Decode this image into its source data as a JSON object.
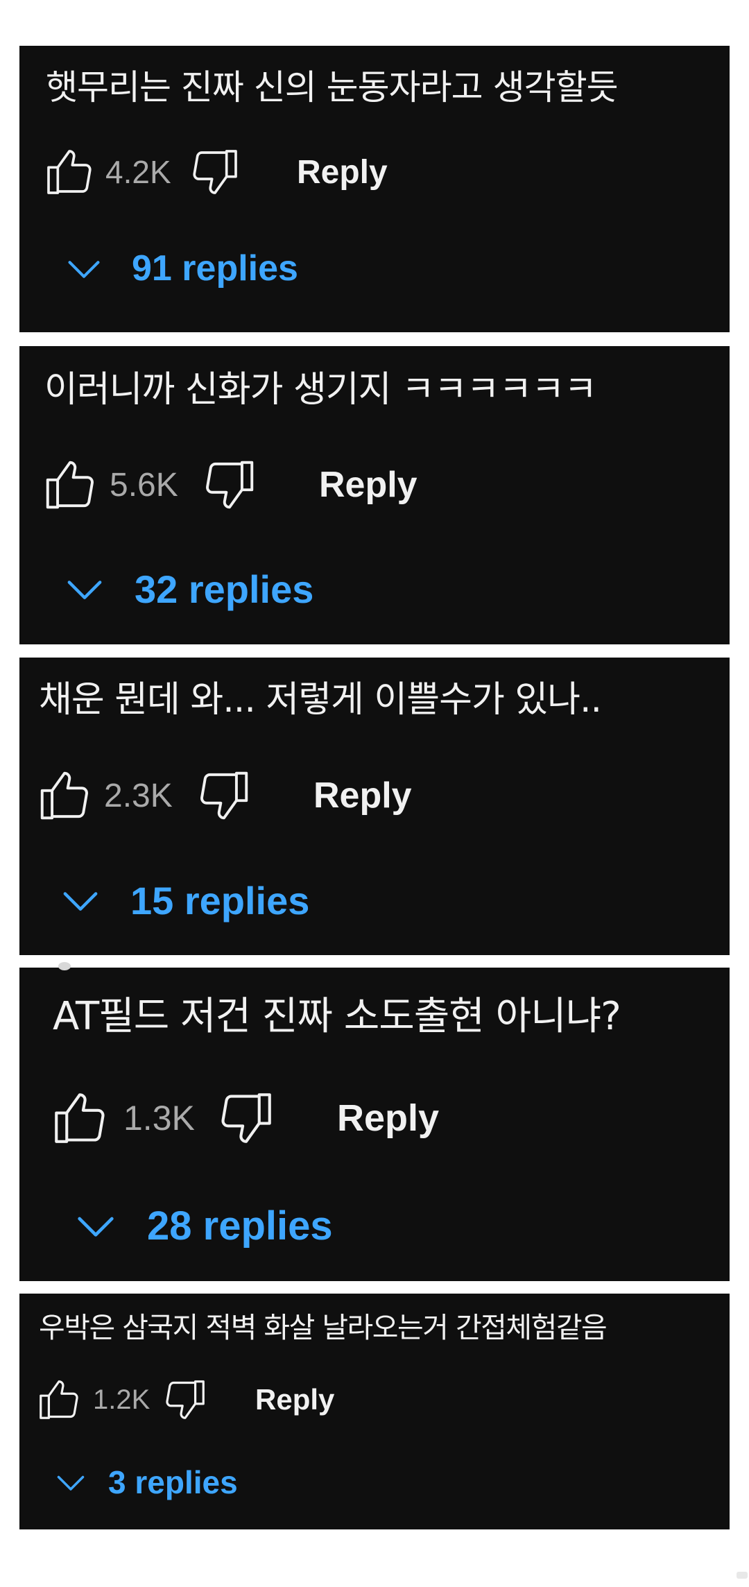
{
  "comments": [
    {
      "text": "햇무리는 진짜 신의 눈동자라고 생각할듯",
      "likes": "4.2K",
      "reply_label": "Reply",
      "replies_label": "91 replies"
    },
    {
      "text": "이러니까 신화가 생기지 ㅋㅋㅋㅋㅋㅋ",
      "likes": "5.6K",
      "reply_label": "Reply",
      "replies_label": "32 replies"
    },
    {
      "text": "채운 뭔데 와... 저렇게 이쁠수가 있나..",
      "likes": "2.3K",
      "reply_label": "Reply",
      "replies_label": "15 replies"
    },
    {
      "text": "AT필드 저건 진짜 소도출현 아니냐?",
      "likes": "1.3K",
      "reply_label": "Reply",
      "replies_label": "28 replies"
    },
    {
      "text": "우박은 삼국지 적벽 화살 날라오는거 간접체험같음",
      "likes": "1.2K",
      "reply_label": "Reply",
      "replies_label": "3 replies"
    }
  ],
  "icons": {
    "like": "thumbs-up-icon",
    "dislike": "thumbs-down-icon",
    "expand": "chevron-down-icon"
  },
  "colors": {
    "card_background": "#0f0f0f",
    "text": "#f1f1f1",
    "count": "#aaaaaa",
    "replies_link": "#3ea6ff",
    "page_background": "#ffffff"
  }
}
